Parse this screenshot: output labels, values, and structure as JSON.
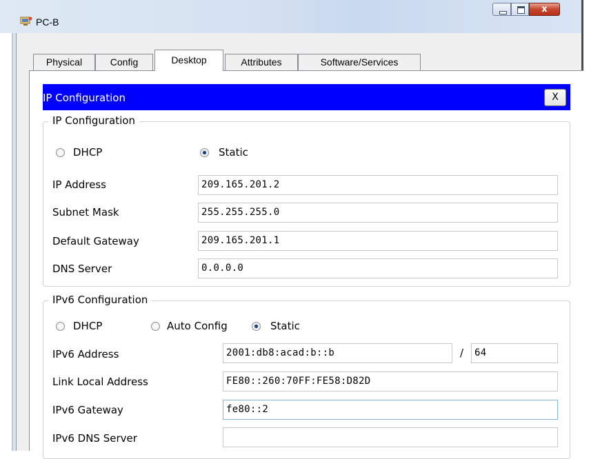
{
  "window": {
    "title": "PC-B",
    "close_glyph": "x"
  },
  "tabs": [
    "Physical",
    "Config",
    "Desktop",
    "Attributes",
    "Software/Services"
  ],
  "active_tab": "Desktop",
  "ip_config_bar": {
    "title": "IP Configuration",
    "close_label": "X",
    "color": "#0000ff"
  },
  "ipv4": {
    "group_title": "IP Configuration",
    "mode_options": [
      "DHCP",
      "Static"
    ],
    "selected_mode": "Static",
    "fields": [
      {
        "label": "IP Address",
        "value": "209.165.201.2"
      },
      {
        "label": "Subnet Mask",
        "value": "255.255.255.0"
      },
      {
        "label": "Default Gateway",
        "value": "209.165.201.1"
      },
      {
        "label": "DNS Server",
        "value": "0.0.0.0"
      }
    ]
  },
  "ipv6": {
    "group_title": "IPv6 Configuration",
    "mode_options": [
      "DHCP",
      "Auto Config",
      "Static"
    ],
    "selected_mode": "Static",
    "address": {
      "label": "IPv6 Address",
      "value": "2001:db8:acad:b::b",
      "separator": "/",
      "prefix": "64"
    },
    "link_local": {
      "label": "Link Local Address",
      "value": "FE80::260:70FF:FE58:D82D"
    },
    "gateway": {
      "label": "IPv6 Gateway",
      "value": "fe80::2"
    },
    "dns": {
      "label": "IPv6 DNS Server",
      "value": ""
    }
  }
}
